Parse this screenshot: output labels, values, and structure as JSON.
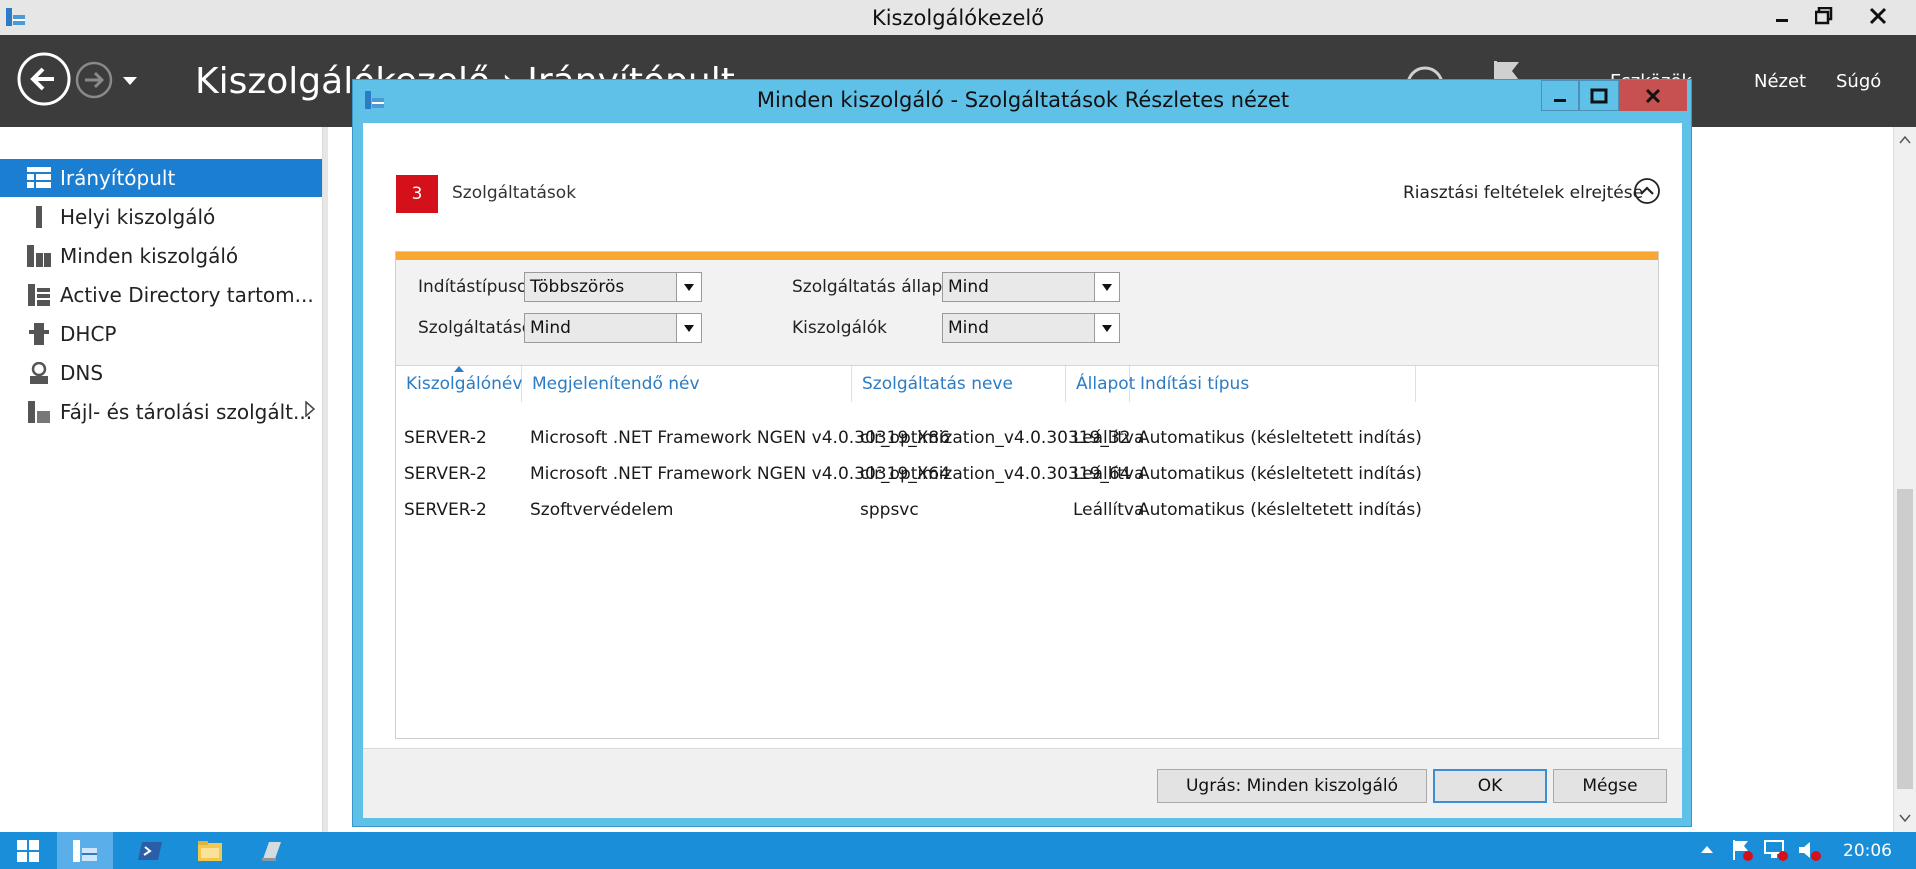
{
  "app": {
    "title": "Kiszolgálókezelő",
    "breadcrumb": "Kiszolgálókezelő  ›  Irányítópult",
    "menu": [
      "Eszközök",
      "Nézet",
      "Súgó"
    ]
  },
  "sidebar": {
    "items": [
      {
        "label": "Irányítópult",
        "icon": "dashboard-icon"
      },
      {
        "label": "Helyi kiszolgáló",
        "icon": "local-server-icon"
      },
      {
        "label": "Minden kiszolgáló",
        "icon": "all-servers-icon"
      },
      {
        "label": "Active Directory tartom...",
        "icon": "active-directory-icon"
      },
      {
        "label": "DHCP",
        "icon": "dhcp-icon"
      },
      {
        "label": "DNS",
        "icon": "dns-icon"
      },
      {
        "label": "Fájl- és tárolási szolgált...",
        "icon": "file-storage-icon"
      }
    ]
  },
  "dialog": {
    "title": "Minden kiszolgáló - Szolgáltatások Részletes nézet",
    "count": "3",
    "section_title": "Szolgáltatások",
    "hide_criteria": "Riasztási feltételek elrejtése",
    "filters": {
      "startup_label": "Indítástípusok",
      "startup_value": "Többszörös",
      "services_label": "Szolgáltatások",
      "services_value": "Mind",
      "status_label": "Szolgáltatás állapota",
      "status_value": "Mind",
      "servers_label": "Kiszolgálók",
      "servers_value": "Mind"
    },
    "columns": [
      "Kiszolgálónév",
      "Megjelenítendő név",
      "Szolgáltatás neve",
      "Állapot",
      "Indítási típus"
    ],
    "rows": [
      [
        "SERVER-2",
        "Microsoft .NET Framework NGEN v4.0.30319_X86",
        "clr_optimization_v4.0.30319_32",
        "Leállítva",
        "Automatikus (késleltetett indítás)"
      ],
      [
        "SERVER-2",
        "Microsoft .NET Framework NGEN v4.0.30319_X64",
        "clr_optimization_v4.0.30319_64",
        "Leállítva",
        "Automatikus (késleltetett indítás)"
      ],
      [
        "SERVER-2",
        "Szoftvervédelem",
        "sppsvc",
        "Leállítva",
        "Automatikus (késleltetett indítás)"
      ]
    ],
    "buttons": {
      "goto": "Ugrás: Minden kiszolgáló",
      "ok": "OK",
      "cancel": "Mégse"
    }
  },
  "taskbar": {
    "clock": "20:06"
  },
  "colors": {
    "accent": "#1b7ed1",
    "dialog_frame": "#5fc1e8",
    "alert_badge": "#d4101b",
    "alert_bar": "#f8a733",
    "taskbar": "#1a8ed8"
  }
}
